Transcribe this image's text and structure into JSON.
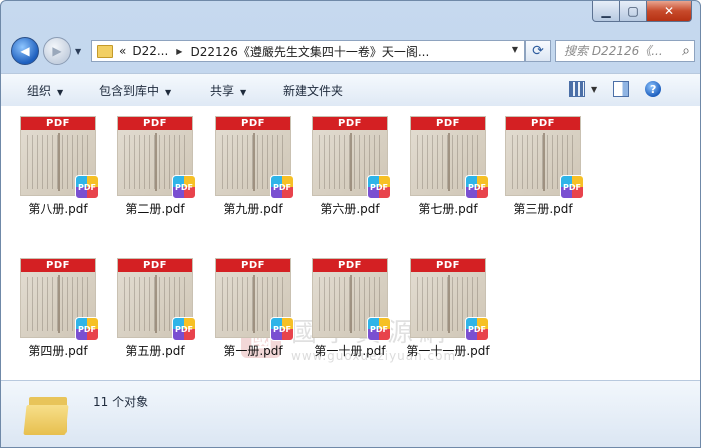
{
  "window": {
    "caption": {
      "minimize": "▁",
      "maximize": "▢",
      "close": "✕"
    }
  },
  "nav": {
    "address": {
      "prefix": "«",
      "crumbs": [
        "D22...",
        "D22126《遵嚴先生文集四十一卷》天一阁..."
      ]
    },
    "search_placeholder": "搜索 D22126《..."
  },
  "toolbar": {
    "organize": "组织",
    "include_in_library": "包含到库中",
    "share": "共享",
    "new_folder": "新建文件夹"
  },
  "files": [
    {
      "name": "第八册.pdf"
    },
    {
      "name": "第二册.pdf"
    },
    {
      "name": "第九册.pdf"
    },
    {
      "name": "第六册.pdf"
    },
    {
      "name": "第七册.pdf"
    },
    {
      "name": "第三册.pdf"
    },
    {
      "name": "第四册.pdf"
    },
    {
      "name": "第五册.pdf"
    },
    {
      "name": "第一册.pdf"
    },
    {
      "name": "第一十册.pdf"
    },
    {
      "name": "第一十一册.pdf"
    }
  ],
  "thumb_band": "PDF",
  "thumb_badge": "PDF",
  "watermark": {
    "seal": "國",
    "text": "國學資源網",
    "url": "www.guoxueziyuan.com"
  },
  "status": {
    "count_text": "11 个对象"
  },
  "colors": {
    "pdf_red": "#d42023",
    "toolbar_bg": "#dfe9f5",
    "chrome": "#c6d9ef"
  }
}
